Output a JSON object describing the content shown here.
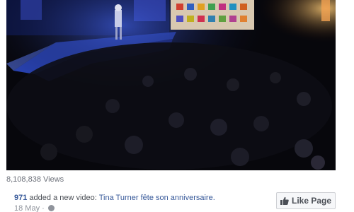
{
  "video": {
    "views": "8,108,838 Views"
  },
  "post": {
    "author": "971",
    "action": "added a new video:",
    "video_title": "Tina Turner fête son anniversaire.",
    "date": "18 May",
    "separator": "·"
  },
  "like_page": {
    "label": "Like Page",
    "icon": "thumbs-up-icon"
  },
  "colors": {
    "link": "#365899",
    "meta": "#90949c",
    "button_bg": "#f6f7f9"
  }
}
